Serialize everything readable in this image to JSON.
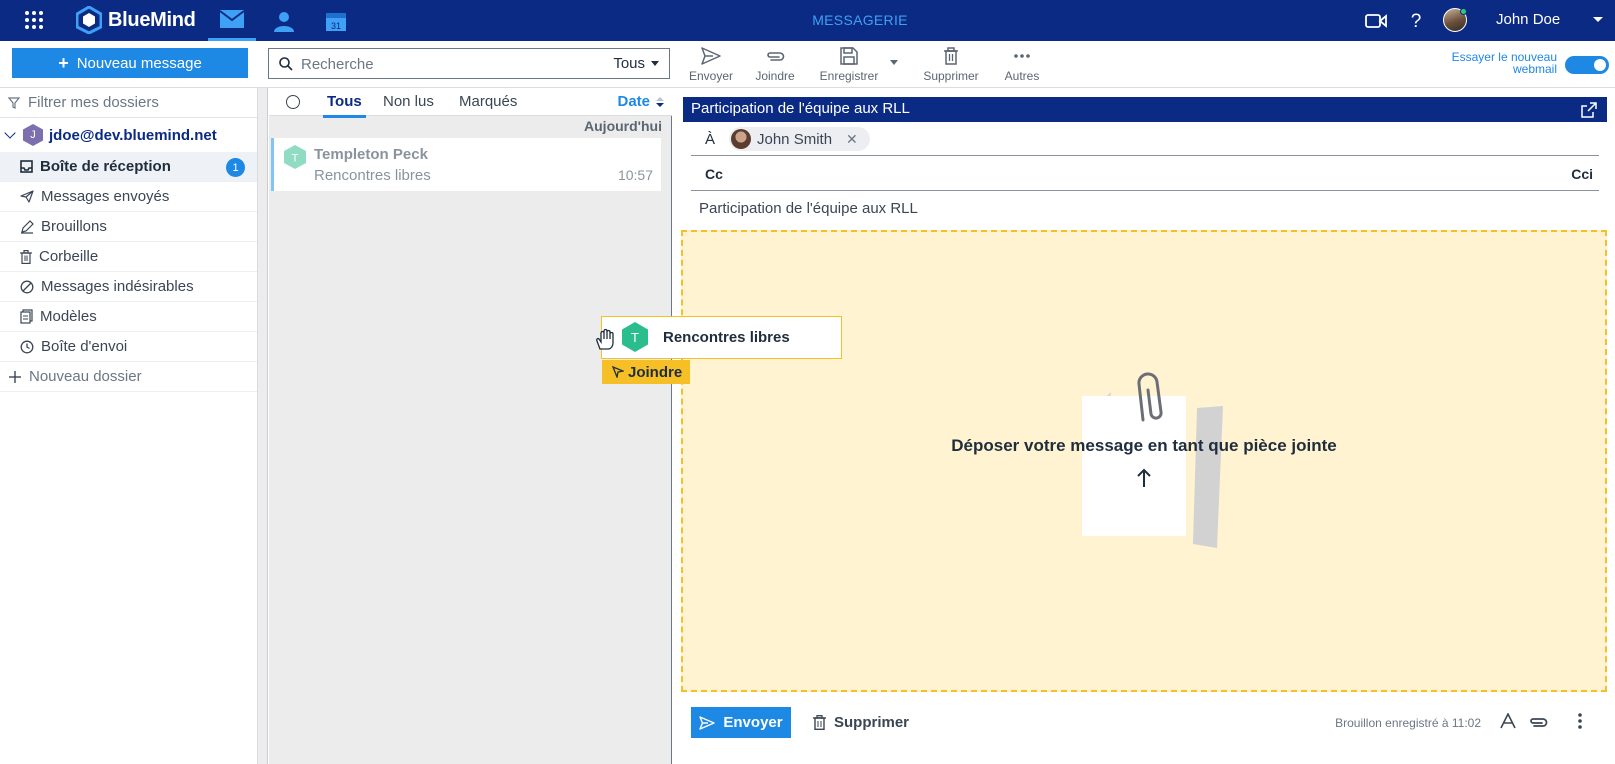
{
  "topbar": {
    "brand": "BlueMind",
    "app_title": "MESSAGERIE",
    "user_name": "John Doe"
  },
  "toolbar": {
    "new_message": "Nouveau message",
    "search_placeholder": "Recherche",
    "search_scope": "Tous",
    "send": "Envoyer",
    "attach": "Joindre",
    "save": "Enregistrer",
    "delete": "Supprimer",
    "more": "Autres",
    "try_new_line1": "Essayer le nouveau",
    "try_new_line2": "webmail"
  },
  "sidebar": {
    "filter_placeholder": "Filtrer mes dossiers",
    "account": "jdoe@dev.bluemind.net",
    "account_initial": "J",
    "folders": [
      {
        "label": "Boîte de réception",
        "badge": "1"
      },
      {
        "label": "Messages envoyés"
      },
      {
        "label": "Brouillons"
      },
      {
        "label": "Corbeille"
      },
      {
        "label": "Messages indésirables"
      },
      {
        "label": "Modèles"
      },
      {
        "label": "Boîte d'envoi"
      }
    ],
    "new_folder": "Nouveau dossier"
  },
  "list": {
    "tabs": [
      "Tous",
      "Non lus",
      "Marqués"
    ],
    "sort": "Date",
    "group": "Aujourd'hui",
    "messages": [
      {
        "initial": "T",
        "from": "Templeton Peck",
        "subject": "Rencontres libres",
        "time": "10:57"
      }
    ]
  },
  "composer": {
    "title": "Participation de l'équipe aux RLL",
    "to_label": "À",
    "to_recipient": "John Smith",
    "cc_label": "Cc",
    "bcc_label": "Cci",
    "subject": "Participation de l'équipe aux RLL",
    "drop_text": "Déposer votre message en tant que pièce jointe",
    "send": "Envoyer",
    "delete": "Supprimer",
    "draft_status": "Brouillon enregistré à 11:02"
  },
  "drag": {
    "initial": "T",
    "label": "Rencontres libres",
    "action": "Joindre"
  },
  "colors": {
    "nav": "#0b2a83",
    "accent": "#1e88e5",
    "drop_bg": "#fff3d1",
    "drop_border": "#f6bf26",
    "avatar_green": "#2bbd8e"
  }
}
